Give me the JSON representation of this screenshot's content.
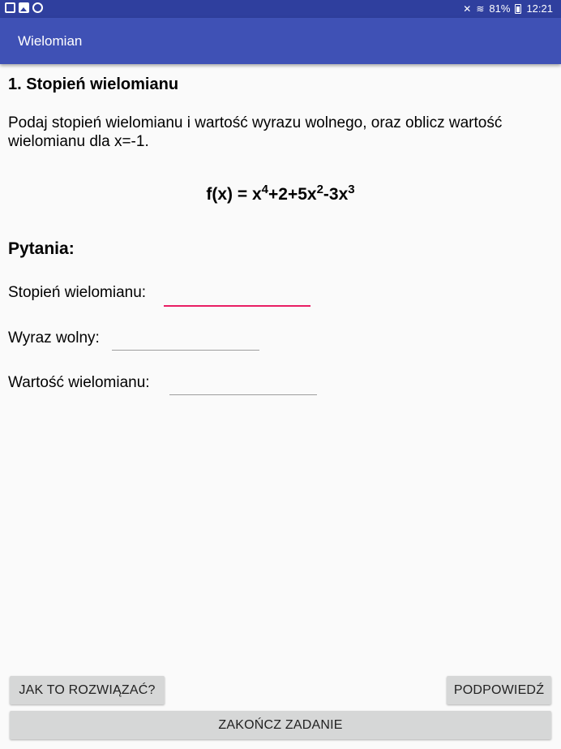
{
  "status_bar": {
    "battery": "81%",
    "time": "12:21",
    "left_icons": [
      "screen-icon",
      "image-icon",
      "sync-icon"
    ],
    "right_icons": [
      "mute-icon",
      "wifi-icon",
      "battery-icon"
    ]
  },
  "app_bar": {
    "title": "Wielomian"
  },
  "task": {
    "title": "1. Stopień wielomianu",
    "description": "Podaj stopień wielomianu i wartość wyrazu wolnego, oraz oblicz wartość wielomianu dla x=-1.",
    "formula": {
      "prefix": "f(x) = x",
      "exp1": "4",
      "mid": "+2+5x",
      "exp2": "2",
      "mid2": "-3x",
      "exp3": "3"
    }
  },
  "questions": {
    "heading": "Pytania:",
    "degree_label": "Stopień wielomianu:",
    "degree_value": "",
    "free_term_label": "Wyraz wolny:",
    "free_term_value": "",
    "value_label": "Wartość wielomianu:",
    "value_value": ""
  },
  "buttons": {
    "how_to": "JAK TO ROZWIĄZAĆ?",
    "hint": "PODPOWIEDŹ",
    "finish": "ZAKOŃCZ ZADANIE"
  },
  "colors": {
    "status_bar": "#2f3f9e",
    "app_bar": "#3f51b5",
    "focus_underline": "#e91e63",
    "button_bg": "#d6d7d7"
  }
}
